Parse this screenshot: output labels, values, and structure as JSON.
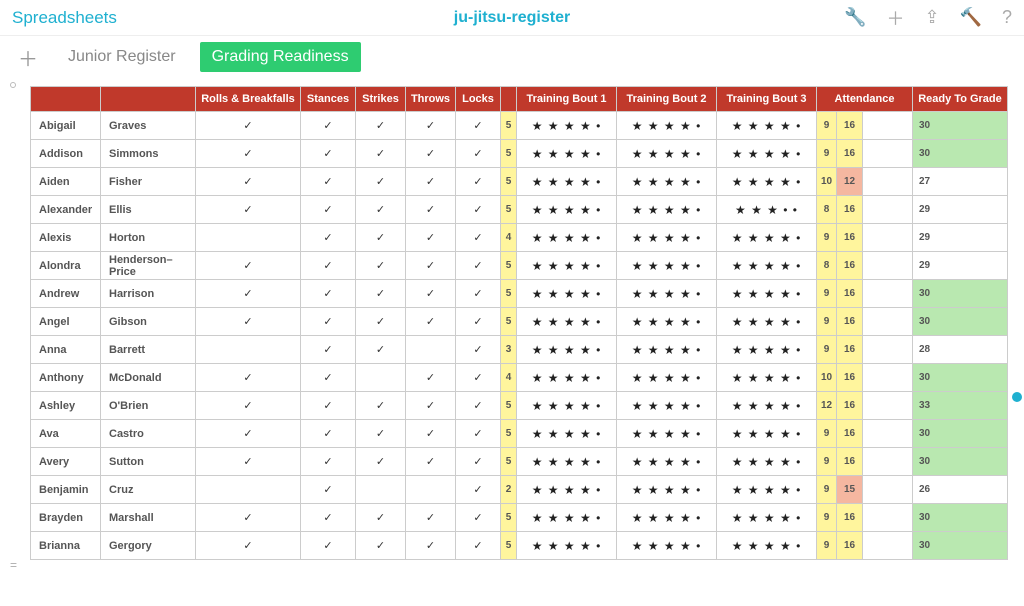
{
  "titlebar": {
    "left": "Spreadsheets",
    "center": "ju-jitsu-register"
  },
  "tabs": {
    "junior": "Junior Register",
    "grading": "Grading Readiness"
  },
  "headers": {
    "rolls": "Rolls & Breakfalls",
    "stances": "Stances",
    "strikes": "Strikes",
    "throws": "Throws",
    "locks": "Locks",
    "tb1": "Training Bout 1",
    "tb2": "Training Bout 2",
    "tb3": "Training Bout 3",
    "attendance": "Attendance",
    "ready": "Ready To Grade"
  },
  "rows": [
    {
      "first": "Abigail",
      "last": "Graves",
      "rolls": true,
      "stances": true,
      "strikes": true,
      "throws": true,
      "locks": true,
      "n": 5,
      "s1": 4,
      "s2": 4,
      "s3": 4,
      "a1": 9,
      "a2": 16,
      "a2c": "hi",
      "g": 30,
      "ok": true
    },
    {
      "first": "Addison",
      "last": "Simmons",
      "rolls": true,
      "stances": true,
      "strikes": true,
      "throws": true,
      "locks": true,
      "n": 5,
      "s1": 4,
      "s2": 4,
      "s3": 4,
      "a1": 9,
      "a2": 16,
      "a2c": "hi",
      "g": 30,
      "ok": true
    },
    {
      "first": "Aiden",
      "last": "Fisher",
      "rolls": true,
      "stances": true,
      "strikes": true,
      "throws": true,
      "locks": true,
      "n": 5,
      "s1": 4,
      "s2": 4,
      "s3": 4,
      "a1": 10,
      "a2": 12,
      "a2c": "lo",
      "g": 27,
      "ok": false
    },
    {
      "first": "Alexander",
      "last": "Ellis",
      "rolls": true,
      "stances": true,
      "strikes": true,
      "throws": true,
      "locks": true,
      "n": 5,
      "s1": 4,
      "s2": 4,
      "s3": 3,
      "a1": 8,
      "a2": 16,
      "a2c": "hi",
      "g": 29,
      "ok": false
    },
    {
      "first": "Alexis",
      "last": "Horton",
      "rolls": false,
      "stances": true,
      "strikes": true,
      "throws": true,
      "locks": true,
      "n": 4,
      "s1": 4,
      "s2": 4,
      "s3": 4,
      "a1": 9,
      "a2": 16,
      "a2c": "hi",
      "g": 29,
      "ok": false
    },
    {
      "first": "Alondra",
      "last": "Henderson–Price",
      "rolls": true,
      "stances": true,
      "strikes": true,
      "throws": true,
      "locks": true,
      "n": 5,
      "s1": 4,
      "s2": 4,
      "s3": 4,
      "a1": 8,
      "a2": 16,
      "a2c": "hi",
      "g": 29,
      "ok": false
    },
    {
      "first": "Andrew",
      "last": "Harrison",
      "rolls": true,
      "stances": true,
      "strikes": true,
      "throws": true,
      "locks": true,
      "n": 5,
      "s1": 4,
      "s2": 4,
      "s3": 4,
      "a1": 9,
      "a2": 16,
      "a2c": "hi",
      "g": 30,
      "ok": true
    },
    {
      "first": "Angel",
      "last": "Gibson",
      "rolls": true,
      "stances": true,
      "strikes": true,
      "throws": true,
      "locks": true,
      "n": 5,
      "s1": 4,
      "s2": 4,
      "s3": 4,
      "a1": 9,
      "a2": 16,
      "a2c": "hi",
      "g": 30,
      "ok": true
    },
    {
      "first": "Anna",
      "last": "Barrett",
      "rolls": false,
      "stances": true,
      "strikes": true,
      "throws": false,
      "locks": true,
      "n": 3,
      "s1": 4,
      "s2": 4,
      "s3": 4,
      "a1": 9,
      "a2": 16,
      "a2c": "hi",
      "g": 28,
      "ok": false
    },
    {
      "first": "Anthony",
      "last": "McDonald",
      "rolls": true,
      "stances": true,
      "strikes": false,
      "throws": true,
      "locks": true,
      "n": 4,
      "s1": 4,
      "s2": 4,
      "s3": 4,
      "a1": 10,
      "a2": 16,
      "a2c": "hi",
      "g": 30,
      "ok": true
    },
    {
      "first": "Ashley",
      "last": "O'Brien",
      "rolls": true,
      "stances": true,
      "strikes": true,
      "throws": true,
      "locks": true,
      "n": 5,
      "s1": 4,
      "s2": 4,
      "s3": 4,
      "a1": 12,
      "a2": 16,
      "a2c": "hi",
      "g": 33,
      "ok": true
    },
    {
      "first": "Ava",
      "last": "Castro",
      "rolls": true,
      "stances": true,
      "strikes": true,
      "throws": true,
      "locks": true,
      "n": 5,
      "s1": 4,
      "s2": 4,
      "s3": 4,
      "a1": 9,
      "a2": 16,
      "a2c": "hi",
      "g": 30,
      "ok": true
    },
    {
      "first": "Avery",
      "last": "Sutton",
      "rolls": true,
      "stances": true,
      "strikes": true,
      "throws": true,
      "locks": true,
      "n": 5,
      "s1": 4,
      "s2": 4,
      "s3": 4,
      "a1": 9,
      "a2": 16,
      "a2c": "hi",
      "g": 30,
      "ok": true
    },
    {
      "first": "Benjamin",
      "last": "Cruz",
      "rolls": false,
      "stances": true,
      "strikes": false,
      "throws": false,
      "locks": true,
      "n": 2,
      "s1": 4,
      "s2": 4,
      "s3": 4,
      "a1": 9,
      "a2": 15,
      "a2c": "lo",
      "g": 26,
      "ok": false
    },
    {
      "first": "Brayden",
      "last": "Marshall",
      "rolls": true,
      "stances": true,
      "strikes": true,
      "throws": true,
      "locks": true,
      "n": 5,
      "s1": 4,
      "s2": 4,
      "s3": 4,
      "a1": 9,
      "a2": 16,
      "a2c": "hi",
      "g": 30,
      "ok": true
    },
    {
      "first": "Brianna",
      "last": "Gergory",
      "rolls": true,
      "stances": true,
      "strikes": true,
      "throws": true,
      "locks": true,
      "n": 5,
      "s1": 4,
      "s2": 4,
      "s3": 4,
      "a1": 9,
      "a2": 16,
      "a2c": "hi",
      "g": 30,
      "ok": true
    }
  ]
}
